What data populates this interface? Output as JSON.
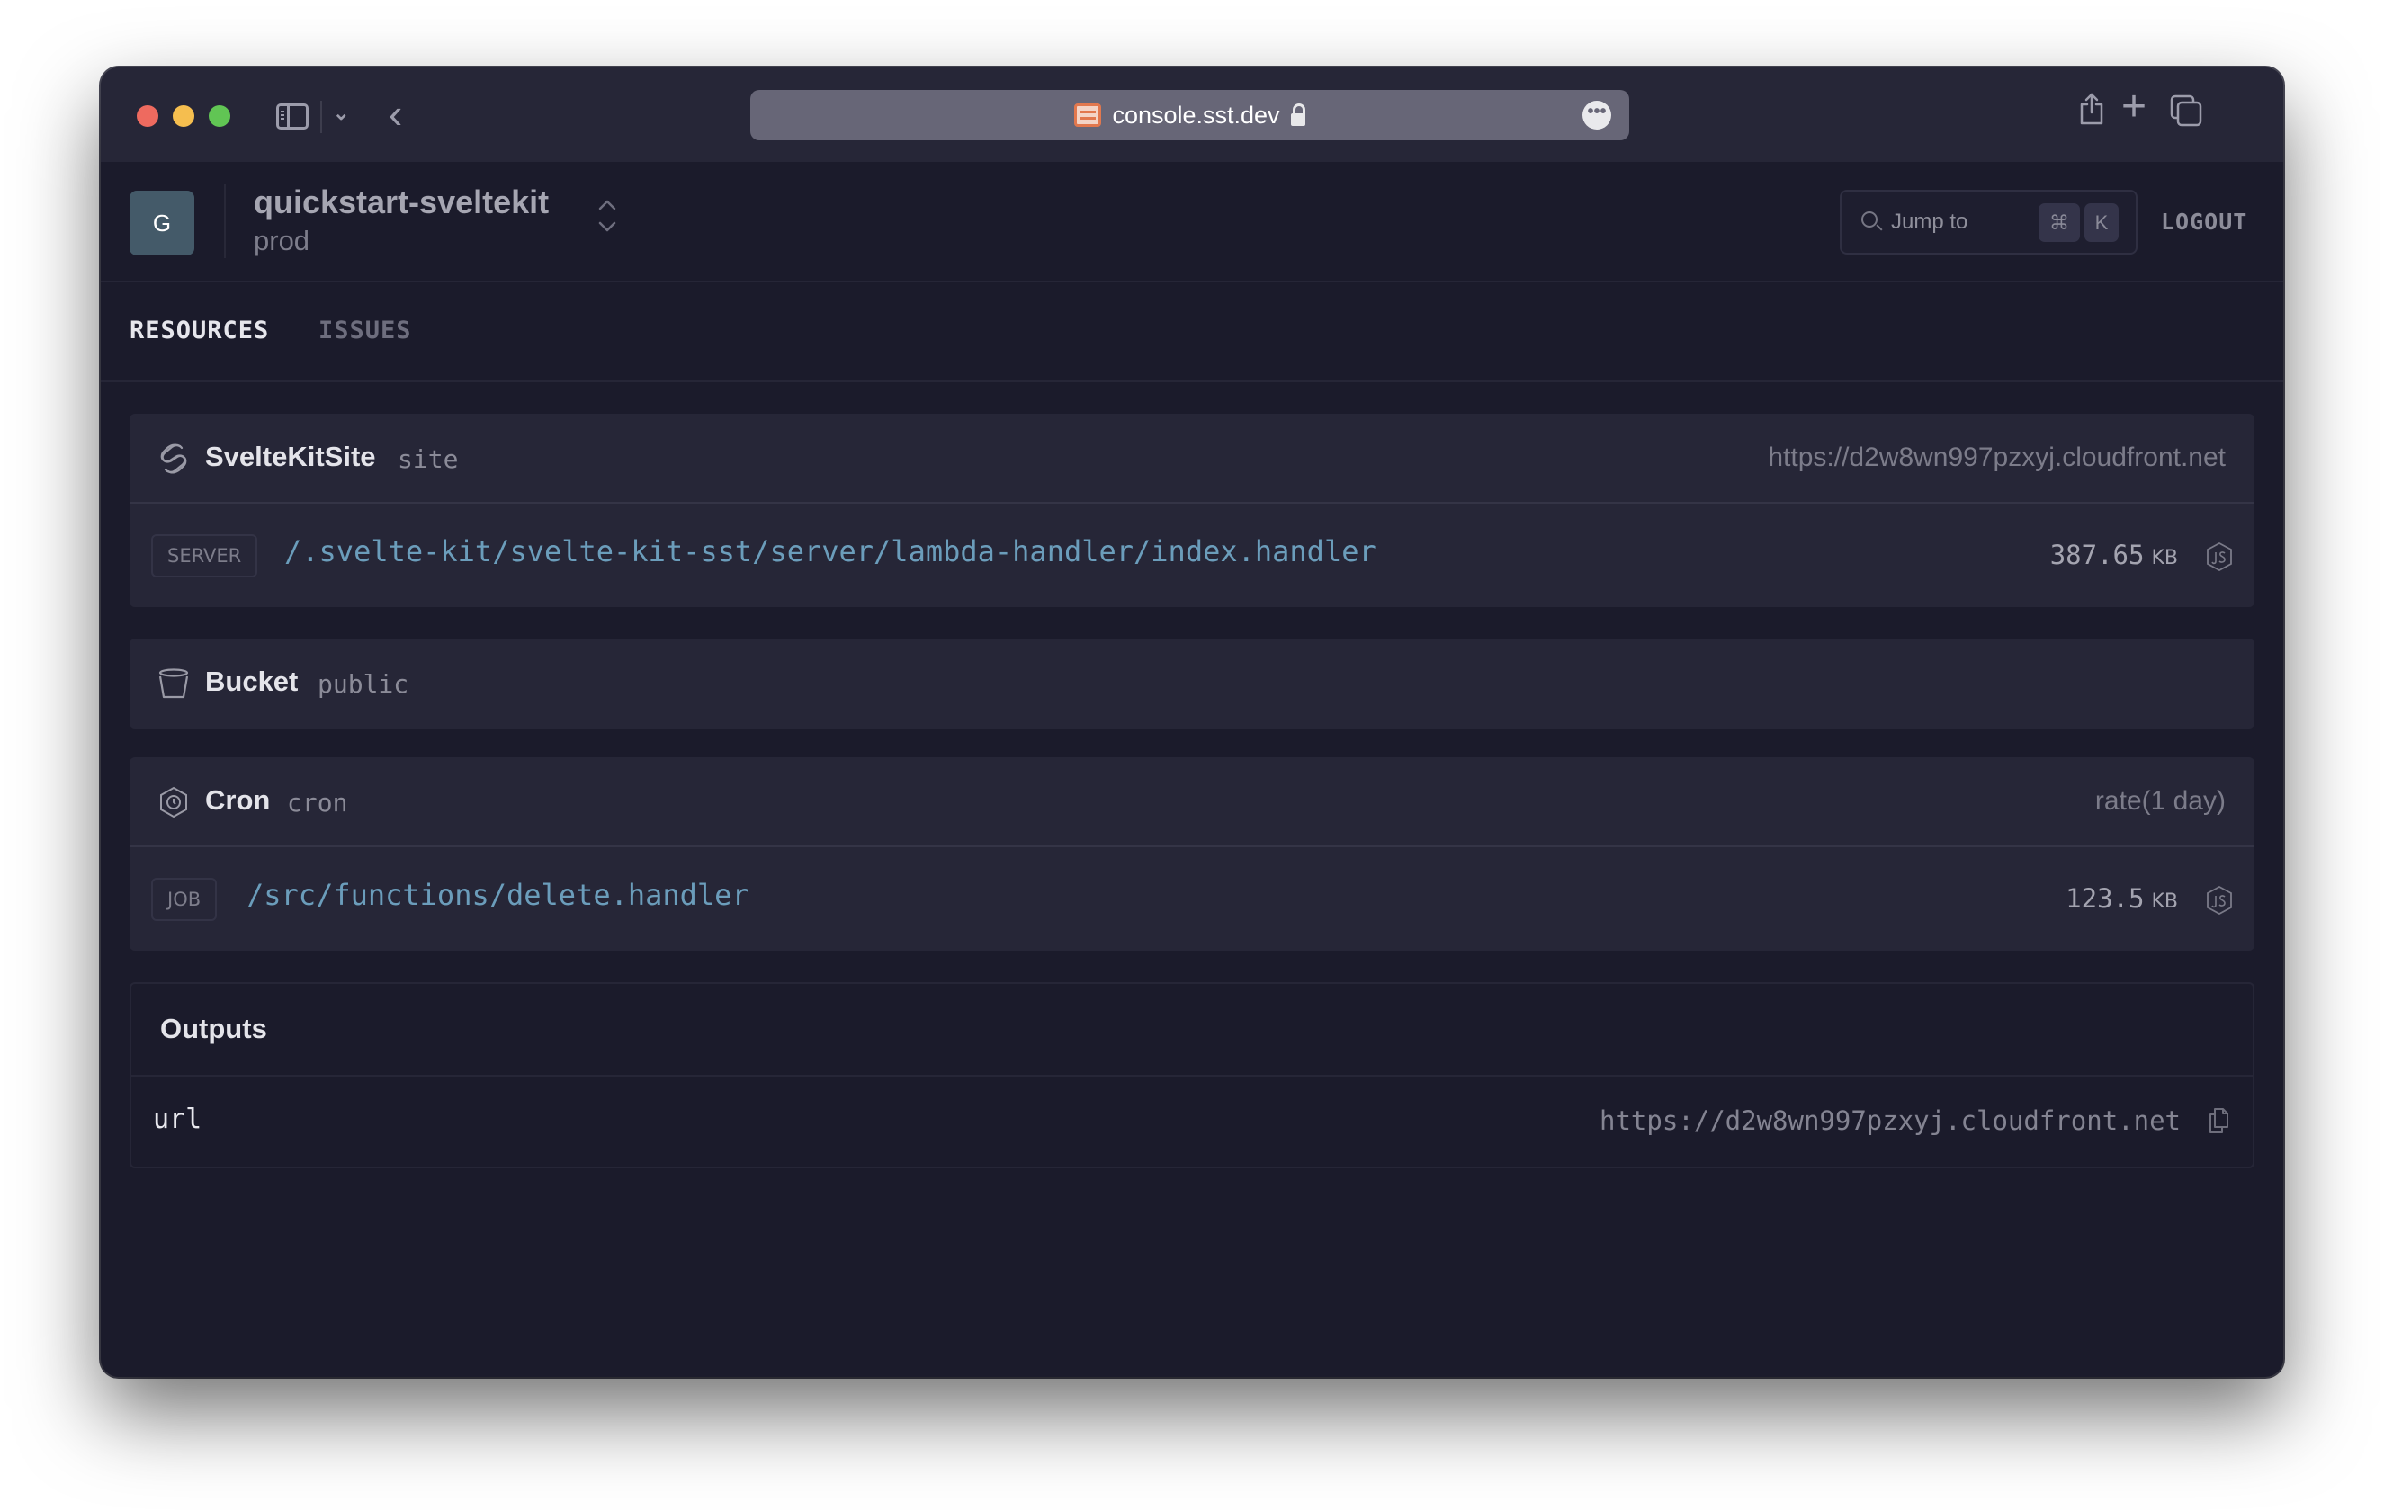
{
  "browser": {
    "url": "console.sst.dev",
    "more_label": "•••",
    "back_label": "‹",
    "dropdown_label": "⌄",
    "new_tab_label": "+"
  },
  "header": {
    "avatar_letter": "G",
    "app_name": "quickstart-sveltekit",
    "stage": "prod",
    "switcher_up": "⌃",
    "switcher_down": "⌄",
    "jump_placeholder": "Jump to",
    "shortcut_cmd": "⌘",
    "shortcut_key": "K",
    "logout_label": "LOGOUT"
  },
  "tabs": [
    {
      "label": "RESOURCES",
      "active": true
    },
    {
      "label": "ISSUES",
      "active": false
    }
  ],
  "resources": [
    {
      "name": "SvelteKitSite",
      "type": "site",
      "icon": "svelte-icon",
      "meta": "https://d2w8wn997pzxyj.cloudfront.net",
      "function": {
        "tag": "SERVER",
        "handler": "/.svelte-kit/svelte-kit-sst/server/lambda-handler/index.handler",
        "size": "387.65",
        "unit": "KB",
        "runtime_icon": "nodejs-icon"
      }
    },
    {
      "name": "Bucket",
      "type": "public",
      "icon": "bucket-icon"
    },
    {
      "name": "Cron",
      "type": "cron",
      "icon": "cron-clock-icon",
      "meta": "rate(1 day)",
      "function": {
        "tag": "JOB",
        "handler": "/src/functions/delete.handler",
        "size": "123.5",
        "unit": "KB",
        "runtime_icon": "nodejs-icon"
      }
    }
  ],
  "outputs": {
    "title": "Outputs",
    "rows": [
      {
        "key": "url",
        "value": "https://d2w8wn997pzxyj.cloudfront.net"
      }
    ]
  }
}
